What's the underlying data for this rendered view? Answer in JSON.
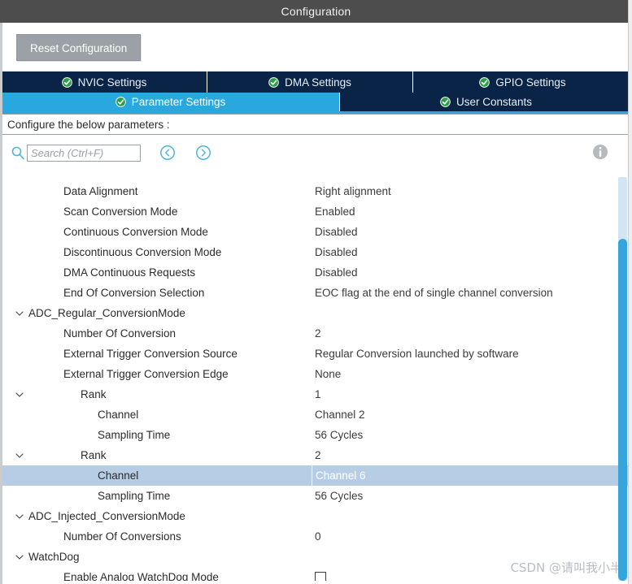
{
  "window": {
    "title": "Configuration"
  },
  "toolbar": {
    "reset_label": "Reset Configuration"
  },
  "tabs_row1": [
    {
      "label": "NVIC Settings",
      "icon": "check-circle-icon",
      "active": false
    },
    {
      "label": "DMA Settings",
      "icon": "check-circle-icon",
      "active": false
    },
    {
      "label": "GPIO Settings",
      "icon": "check-circle-icon",
      "active": false
    }
  ],
  "tabs_row2": [
    {
      "label": "Parameter Settings",
      "icon": "check-circle-icon",
      "active": true
    },
    {
      "label": "User Constants",
      "icon": "check-circle-icon",
      "active": false
    }
  ],
  "info_strip": {
    "text": "Configure the below parameters :"
  },
  "search": {
    "placeholder": "Search (Ctrl+F)",
    "value": "",
    "icon": "search-icon",
    "prev_icon": "chevron-left-circle-icon",
    "next_icon": "chevron-right-circle-icon",
    "info_icon": "info-icon"
  },
  "colors": {
    "titlebar": "#4d4d4d",
    "tab_inactive": "#0a2447",
    "tab_active": "#29a8df",
    "accent": "#29a8df",
    "selected_row": "#b7cde5",
    "scroll_thumb": "#36a5dc",
    "scroll_track": "#d3e4f2",
    "reset_button": "#9ba1a6"
  },
  "parameters": [
    {
      "indent": 1,
      "label": "",
      "value": "",
      "chevron": false,
      "selected": false,
      "partial": true
    },
    {
      "indent": 1,
      "label": "Data Alignment",
      "value": "Right alignment",
      "chevron": false,
      "selected": false
    },
    {
      "indent": 1,
      "label": "Scan Conversion Mode",
      "value": "Enabled",
      "chevron": false,
      "selected": false
    },
    {
      "indent": 1,
      "label": "Continuous Conversion Mode",
      "value": "Disabled",
      "chevron": false,
      "selected": false
    },
    {
      "indent": 1,
      "label": "Discontinuous Conversion Mode",
      "value": "Disabled",
      "chevron": false,
      "selected": false
    },
    {
      "indent": 1,
      "label": "DMA Continuous Requests",
      "value": "Disabled",
      "chevron": false,
      "selected": false
    },
    {
      "indent": 1,
      "label": "End Of Conversion Selection",
      "value": "EOC flag at the end of single channel conversion",
      "chevron": false,
      "selected": false
    },
    {
      "indent": 0,
      "label": "ADC_Regular_ConversionMode",
      "value": "",
      "chevron": true,
      "selected": false
    },
    {
      "indent": 1,
      "label": "Number Of Conversion",
      "value": "2",
      "chevron": false,
      "selected": false
    },
    {
      "indent": 1,
      "label": "External Trigger Conversion Source",
      "value": "Regular Conversion launched by software",
      "chevron": false,
      "selected": false
    },
    {
      "indent": 1,
      "label": "External Trigger Conversion Edge",
      "value": "None",
      "chevron": false,
      "selected": false
    },
    {
      "indent": 2,
      "label": "Rank",
      "value": "1",
      "chevron": true,
      "selected": false
    },
    {
      "indent": 3,
      "label": "Channel",
      "value": "Channel 2",
      "chevron": false,
      "selected": false
    },
    {
      "indent": 3,
      "label": "Sampling Time",
      "value": "56 Cycles",
      "chevron": false,
      "selected": false
    },
    {
      "indent": 2,
      "label": "Rank",
      "value": "2",
      "chevron": true,
      "selected": false
    },
    {
      "indent": 3,
      "label": "Channel",
      "value": "Channel 6",
      "chevron": false,
      "selected": true
    },
    {
      "indent": 3,
      "label": "Sampling Time",
      "value": "56 Cycles",
      "chevron": false,
      "selected": false
    },
    {
      "indent": 0,
      "label": "ADC_Injected_ConversionMode",
      "value": "",
      "chevron": true,
      "selected": false
    },
    {
      "indent": 1,
      "label": "Number Of Conversions",
      "value": "0",
      "chevron": false,
      "selected": false
    },
    {
      "indent": 0,
      "label": "WatchDog",
      "value": "",
      "chevron": true,
      "selected": false
    },
    {
      "indent": 1,
      "label": "Enable Analog WatchDog Mode",
      "value": "",
      "chevron": false,
      "selected": false,
      "checkbox": true,
      "checked": false
    }
  ],
  "watermark": {
    "text": "CSDN @请叫我小半"
  }
}
